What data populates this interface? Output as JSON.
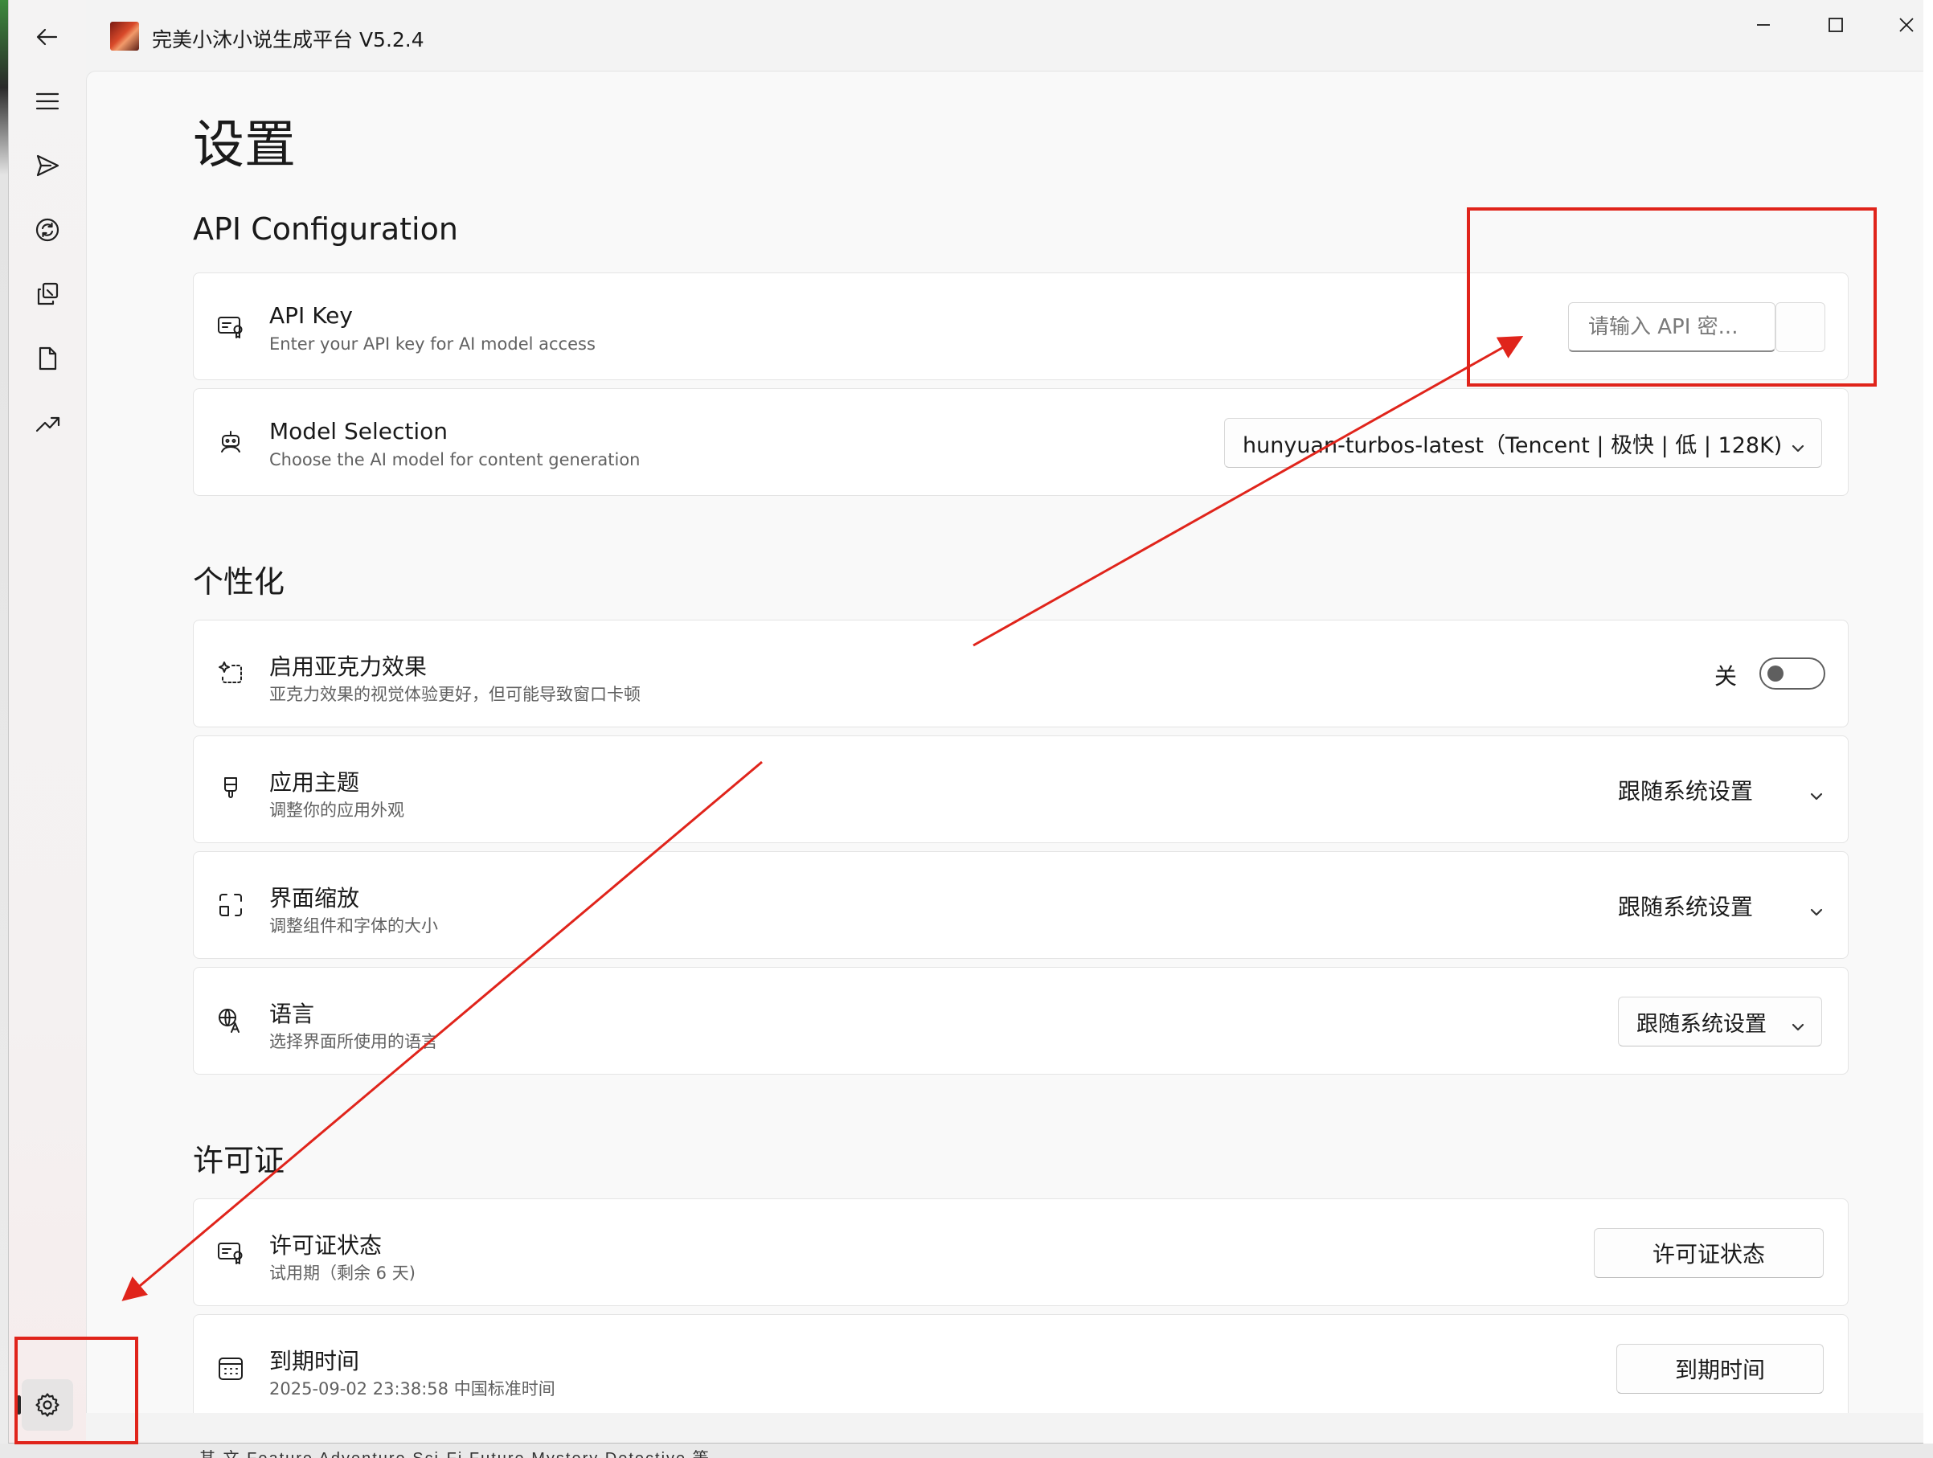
{
  "window": {
    "title": "完美小沐小说生成平台 V5.2.4",
    "controls": {
      "minimize_icon": "minimize-icon",
      "maximize_icon": "maximize-icon",
      "close_icon": "close-icon"
    }
  },
  "sidebar": {
    "items": [
      {
        "name": "back",
        "icon": "arrow-left-icon"
      },
      {
        "name": "menu",
        "icon": "hamburger-icon"
      },
      {
        "name": "send",
        "icon": "paper-plane-icon"
      },
      {
        "name": "sync",
        "icon": "sync-circle-icon"
      },
      {
        "name": "copy-edit",
        "icon": "copy-edit-icon"
      },
      {
        "name": "document",
        "icon": "document-icon"
      },
      {
        "name": "trend",
        "icon": "trending-up-icon"
      }
    ],
    "settings_icon": "gear-icon"
  },
  "page": {
    "title": "设置"
  },
  "sections": {
    "api": {
      "title": "API Configuration",
      "api_key": {
        "title": "API Key",
        "description": "Enter your API key for AI model access",
        "placeholder": "请输入 API 密..."
      },
      "model": {
        "title": "Model Selection",
        "description": "Choose the AI model for content generation",
        "selected": "hunyuan-turbos-latest（Tencent | 极快 | 低 | 128K)"
      }
    },
    "personalization": {
      "title": "个性化",
      "acrylic": {
        "title": "启用亚克力效果",
        "description": "亚克力效果的视觉体验更好，但可能导致窗口卡顿",
        "state_label": "关",
        "enabled": false
      },
      "theme": {
        "title": "应用主题",
        "description": "调整你的应用外观",
        "selected": "跟随系统设置"
      },
      "scale": {
        "title": "界面缩放",
        "description": "调整组件和字体的大小",
        "selected": "跟随系统设置"
      },
      "language": {
        "title": "语言",
        "description": "选择界面所使用的语言",
        "selected": "跟随系统设置"
      }
    },
    "license": {
      "title": "许可证",
      "status": {
        "title": "许可证状态",
        "description": "试用期（剩余 6 天)",
        "button": "许可证状态"
      },
      "expiry": {
        "title": "到期时间",
        "description": "2025-09-02 23:38:58 中国标准时间",
        "button": "到期时间"
      }
    }
  },
  "background_strip_text": "其 文  Feature  Adventure  Sci-Fi Future  Mystery  Detective  等",
  "colors": {
    "annotation_red": "#e0241b",
    "content_bg": "#f9f9f9",
    "card_bg": "#ffffff"
  }
}
